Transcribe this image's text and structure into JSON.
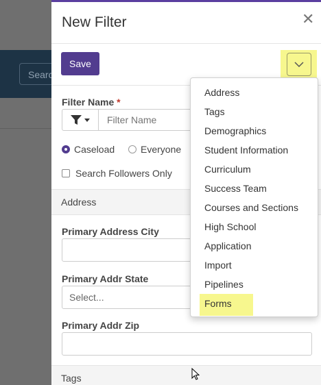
{
  "background": {
    "search_placeholder": "Search"
  },
  "dialog": {
    "title": "New Filter",
    "save_label": "Save",
    "filter_name_label": "Filter Name",
    "required_mark": "*",
    "filter_name_placeholder": "Filter Name",
    "radio_options": [
      {
        "label": "Caseload",
        "selected": true
      },
      {
        "label": "Everyone",
        "selected": false
      }
    ],
    "search_followers_label": "Search Followers Only",
    "sections": {
      "address": "Address",
      "tags": "Tags"
    },
    "fields": {
      "city_label": "Primary Address City",
      "state_label": "Primary Addr State",
      "state_placeholder": "Select...",
      "zip_label": "Primary Addr Zip"
    }
  },
  "dropdown_menu": {
    "items": [
      "Address",
      "Tags",
      "Demographics",
      "Student Information",
      "Curriculum",
      "Success Team",
      "Courses and Sections",
      "High School",
      "Application",
      "Import",
      "Pipelines",
      "Forms"
    ],
    "highlighted_item": "Forms"
  },
  "colors": {
    "accent": "#523c8f",
    "highlight": "#f7f78e",
    "banner": "#1d3345"
  }
}
